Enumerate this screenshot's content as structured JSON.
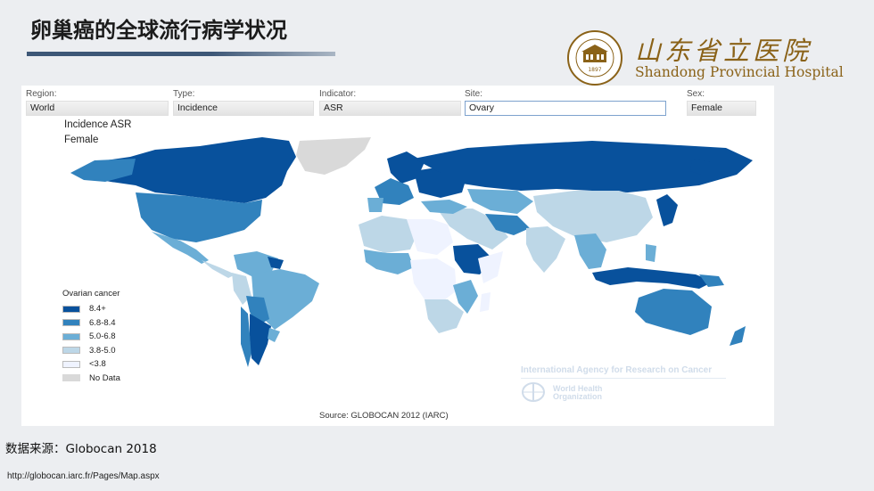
{
  "slide": {
    "title": "卵巢癌的全球流行病学状况",
    "data_source": "数据来源：Globocan 2018",
    "url": "http://globocan.iarc.fr/Pages/Map.aspx"
  },
  "hospital": {
    "name_cn": "山东省立医院",
    "name_en": "Shandong Provincial Hospital",
    "seal_year": "1897",
    "brand_color": "#8a6218"
  },
  "filters": [
    {
      "label": "Region:",
      "value": "World"
    },
    {
      "label": "Type:",
      "value": "Incidence"
    },
    {
      "label": "Indicator:",
      "value": "ASR"
    },
    {
      "label": "Site:",
      "value": "Ovary"
    },
    {
      "label": "Sex:",
      "value": "Female"
    }
  ],
  "map": {
    "title_line1": "Incidence ASR",
    "title_line2": "Female",
    "legend_title": "Ovarian cancer",
    "legend": [
      {
        "label": "8.4+",
        "color": "#08519c"
      },
      {
        "label": "6.8-8.4",
        "color": "#3182bd"
      },
      {
        "label": "5.0-6.8",
        "color": "#6baed6"
      },
      {
        "label": "3.8-5.0",
        "color": "#bdd7e7"
      },
      {
        "label": "<3.8",
        "color": "#eff3ff"
      },
      {
        "label": "No Data",
        "color": "#d9d9d9"
      }
    ],
    "watermark_agency": "International Agency for Research on Cancer",
    "watermark_who_line1": "World Health",
    "watermark_who_line2": "Organization",
    "source": "Source: GLOBOCAN 2012 (IARC)"
  }
}
